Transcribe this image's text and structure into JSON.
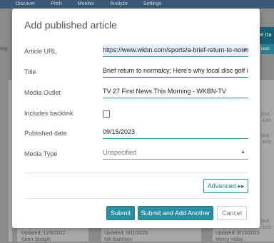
{
  "background": {
    "nav": [
      "Discover",
      "Pitch",
      "Monitor",
      "Analyze",
      "Settings"
    ],
    "right_button_label": "el Da",
    "refresh_label": "resh",
    "left_label": "ring",
    "cards": [
      {
        "updated": "Updated: 12/6/2022",
        "author": "Sean Joseph"
      },
      {
        "updated": "Updated: 9/11/2023",
        "author": "Nik Barkhom"
      },
      {
        "updated": "Updated: 6/13/2023",
        "author": "Mercy Video"
      }
    ],
    "right_meta": [
      "(list)",
      "6/20",
      "(list)",
      "6/20",
      "(list)",
      "1/25"
    ]
  },
  "dialog": {
    "title": "Add published article",
    "fields": {
      "url_label": "Article URL",
      "url_value": "https://www.wkbn.com/sports/a-brief-return-to-normalcy",
      "title_label": "Title",
      "title_value": "Brief return to normalcy: Here's why local disc golf is a",
      "outlet_label": "Media Outlet",
      "outlet_value": "TV 27 First News This Morning - WKBN-TV",
      "backlink_label": "Includes backlink",
      "date_label": "Published date",
      "date_value": "09/15/2023",
      "type_label": "Media Type",
      "type_value": "Unspecified"
    },
    "buttons": {
      "advanced": "Advanced ▸▸",
      "submit": "Submit",
      "submit_add": "Submit and Add Another",
      "cancel": "Cancel"
    }
  },
  "icons": {
    "check": "✓",
    "caret": "▲"
  }
}
